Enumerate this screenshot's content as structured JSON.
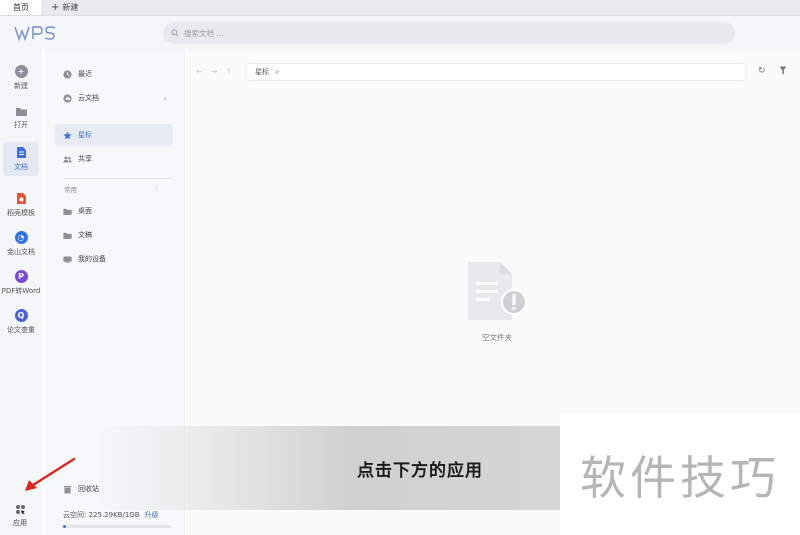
{
  "tabs": [
    {
      "label": "首页",
      "active": true
    },
    {
      "label": "新建",
      "active": false
    }
  ],
  "header": {
    "logo_text": "WPS",
    "search_placeholder": "搜索文档 ..."
  },
  "rail": {
    "items": [
      {
        "label": "新建",
        "icon": "plus-circle-icon",
        "color": "#8a8f99"
      },
      {
        "label": "打开",
        "icon": "folder-icon",
        "color": "#8a8f99"
      },
      {
        "label": "文档",
        "icon": "document-icon",
        "color": "#3e6fd8",
        "active": true
      },
      {
        "label": "稻壳模板",
        "icon": "docer-icon",
        "color": "#e8523b"
      },
      {
        "label": "金山文档",
        "icon": "cloud-doc-icon",
        "color": "#2f74e6"
      },
      {
        "label": "PDF转Word",
        "icon": "pdf-icon",
        "color": "#7a4ad8"
      },
      {
        "label": "论文查重",
        "icon": "paper-check-icon",
        "color": "#4a63d8"
      }
    ],
    "apps_label": "应用"
  },
  "nav": {
    "items": [
      {
        "label": "最近",
        "icon": "clock-icon"
      },
      {
        "label": "云文档",
        "icon": "cloud-icon",
        "has_chevron": true
      },
      {
        "label": "星标",
        "icon": "star-icon",
        "active": true
      },
      {
        "label": "共享",
        "icon": "people-icon"
      }
    ],
    "section_label": "常用",
    "section_more": "⋮",
    "common_items": [
      {
        "label": "桌面",
        "icon": "desktop-folder-icon"
      },
      {
        "label": "文稿",
        "icon": "docs-folder-icon"
      },
      {
        "label": "我的设备",
        "icon": "device-icon"
      }
    ],
    "recycle_label": "回收站",
    "storage_text": "云空间: 225.29KB/1GB",
    "upgrade_label": "升级",
    "storage_used_fraction": 0.03
  },
  "main": {
    "breadcrumb": "星标",
    "breadcrumb_sep": ">",
    "empty_label": "空文件夹"
  },
  "overlay": {
    "instruction": "点击下方的应用",
    "watermark": "软件技巧"
  },
  "colors": {
    "accent": "#3e6fd8",
    "annotation_arrow": "#d9271c"
  }
}
